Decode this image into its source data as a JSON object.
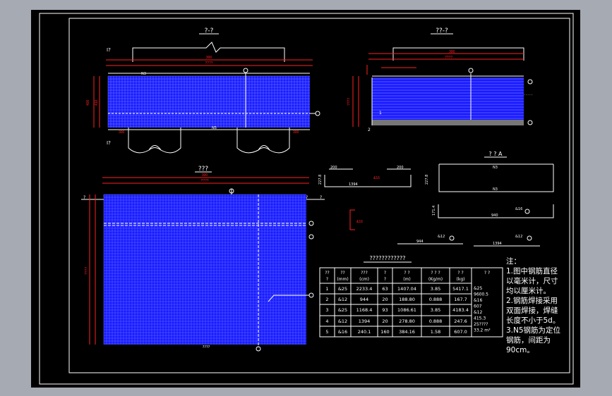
{
  "views": {
    "top_left_title": "?-?",
    "top_right_title": "??-?",
    "plan_title": "???",
    "detail_title": "? ? A",
    "section_marks": [
      "I?",
      "I?"
    ],
    "plan_marks": [
      "?",
      "?",
      "?",
      "?"
    ],
    "bottom_note": "????",
    "labels": {
      "n3": "N3",
      "n5": "N5",
      "l1": "1",
      "l2": "2"
    }
  },
  "dims": {
    "left_total": "????",
    "left_sub": "300",
    "left_h1": "400",
    "left_h2": "410",
    "left_b1": "300",
    "left_b2": "300",
    "right_total": "????",
    "right_sub": "300",
    "right_h": "????",
    "plan_total": "????",
    "plan_sub": "300",
    "plan_h": "????",
    "bar3_w1": "200",
    "bar3_w2": "200",
    "bar3_len": "1394",
    "bar3_h": "227.8",
    "barA_len": "940",
    "barA_h": "227.8",
    "barA_h2": "171.4",
    "bar2_len": "944",
    "bar4_len": "1394",
    "bar_tag_ab": "&16",
    "bar_tag_c": "&12"
  },
  "table": {
    "title": "????????????",
    "headers": [
      "??\n?",
      "??\n(mm)",
      "???\n(cm)",
      "?\n?",
      "?  ?\n(m)",
      "? ? ?\n(Kg/m)",
      "?  ?\n(kg)",
      "?  ?"
    ],
    "rows": [
      [
        "1",
        "&25",
        "2233.4",
        "63",
        "1407.04",
        "3.85",
        "5417.1"
      ],
      [
        "2",
        "&12",
        "944",
        "20",
        "188.80",
        "0.888",
        "167.7"
      ],
      [
        "3",
        "&25",
        "1168.4",
        "93",
        "1086.61",
        "3.85",
        "4183.4"
      ],
      [
        "4",
        "&12",
        "1394",
        "20",
        "278.80",
        "0.888",
        "247.6"
      ],
      [
        "5",
        "&16",
        "240.1",
        "160",
        "384.16",
        "1.58",
        "607.0"
      ]
    ],
    "summary": [
      "&25",
      "9600.5",
      "&16",
      "607",
      "&12",
      "415.3",
      "25????",
      "33.2 m³"
    ]
  },
  "notes": {
    "title": "注：",
    "lines": [
      "1.图中钢筋直径以毫米计，尺寸均以厘米计。",
      "2.钢筋焊接采用双面焊接，焊缝长度不小于5d。",
      "3.N5钢筋为定位钢筋，间距为90cm。"
    ]
  },
  "colors": {
    "background": "#000000",
    "frame": "#ffffff",
    "rebar": "#1a1aff",
    "dimension": "#ff2020",
    "window": "#a6aab3"
  }
}
